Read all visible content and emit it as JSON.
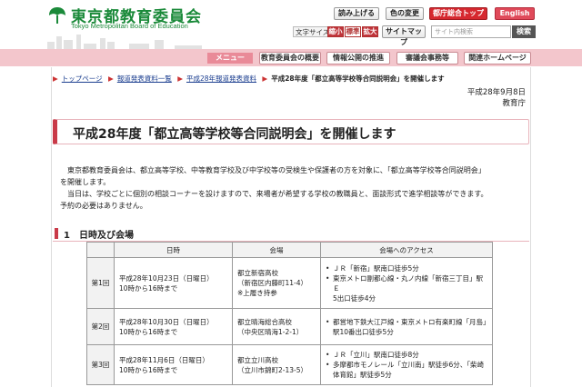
{
  "header": {
    "logo_title": "東京都教育委員会",
    "logo_subtitle": "Tokyo Metropolitan Board of Education",
    "btn_read": "読み上げる",
    "btn_color": "色の変更",
    "btn_gov_top": "都庁総合トップ",
    "btn_english": "English",
    "font_size_label": "文字サイズ",
    "font_small": "縮小",
    "font_standard": "標準",
    "font_large": "拡大",
    "sitemap": "サイトマップ",
    "search_placeholder": "サイト内検索",
    "search_button": "検索",
    "accent_color": "#1b8a3a",
    "brand_red": "#d6282f"
  },
  "nav": {
    "menu_label": "メニュー",
    "items": [
      "教育委員会の概要",
      "情報公開の推進",
      "審議会事務等",
      "関連ホームページ"
    ]
  },
  "breadcrumb": {
    "items": [
      "トップページ",
      "報道発表資料一覧",
      "平成28年報道発表資料"
    ],
    "current": "平成28年度「都立高等学校等合同説明会」を開催します"
  },
  "meta": {
    "date": "平成28年9月8日",
    "org": "教育庁"
  },
  "page": {
    "title": "平成28年度「都立高等学校等合同説明会」を開催します",
    "para1_line1": "東京都教育委員会は、都立高等学校、中等教育学校及び中学校等の受検生や保護者の方を対象に、「都立高等学校等合同説明会」",
    "para1_line2": "を開催します。",
    "para2_line1": "当日は、学校ごとに個別の相談コーナーを設けますので、来場者が希望する学校の教職員と、面談形式で進学相談等ができます。",
    "para2_line2": "予約の必要はありません。"
  },
  "section1": {
    "title": "1　日時及び会場",
    "headers": [
      "",
      "日時",
      "会場",
      "会場へのアクセス"
    ],
    "rows": [
      {
        "round": "第1回",
        "date_line1": "平成28年10月23日（日曜日）",
        "date_line2": "10時から16時まで",
        "venue_line1": "都立新宿高校",
        "venue_line2": "（新宿区内藤町11-4）",
        "venue_line3": "※上履き持参",
        "access": [
          "ＪＲ「新宿」駅南口徒歩5分",
          "東京メトロ副都心線・丸ノ内線「新宿三丁目」駅Ｅ",
          "5出口徒歩4分"
        ]
      },
      {
        "round": "第2回",
        "date_line1": "平成28年10月30日（日曜日）",
        "date_line2": "10時から16時まで",
        "venue_line1": "都立晴海総合高校",
        "venue_line2": "（中央区晴海1-2-1）",
        "venue_line3": "",
        "access": [
          "都営地下鉄大江戸線・東京メトロ有楽町線「月島」",
          "駅10番出口徒歩5分"
        ]
      },
      {
        "round": "第3回",
        "date_line1": "平成28年11月6日（日曜日）",
        "date_line2": "10時から16時まで",
        "venue_line1": "都立立川高校",
        "venue_line2": "（立川市錦町2-13-5）",
        "venue_line3": "",
        "access": [
          "ＪＲ「立川」駅南口徒歩8分",
          "多摩都市モノレール「立川南」駅徒歩6分、「柴崎",
          "体育館」駅徒歩5分"
        ]
      }
    ]
  }
}
